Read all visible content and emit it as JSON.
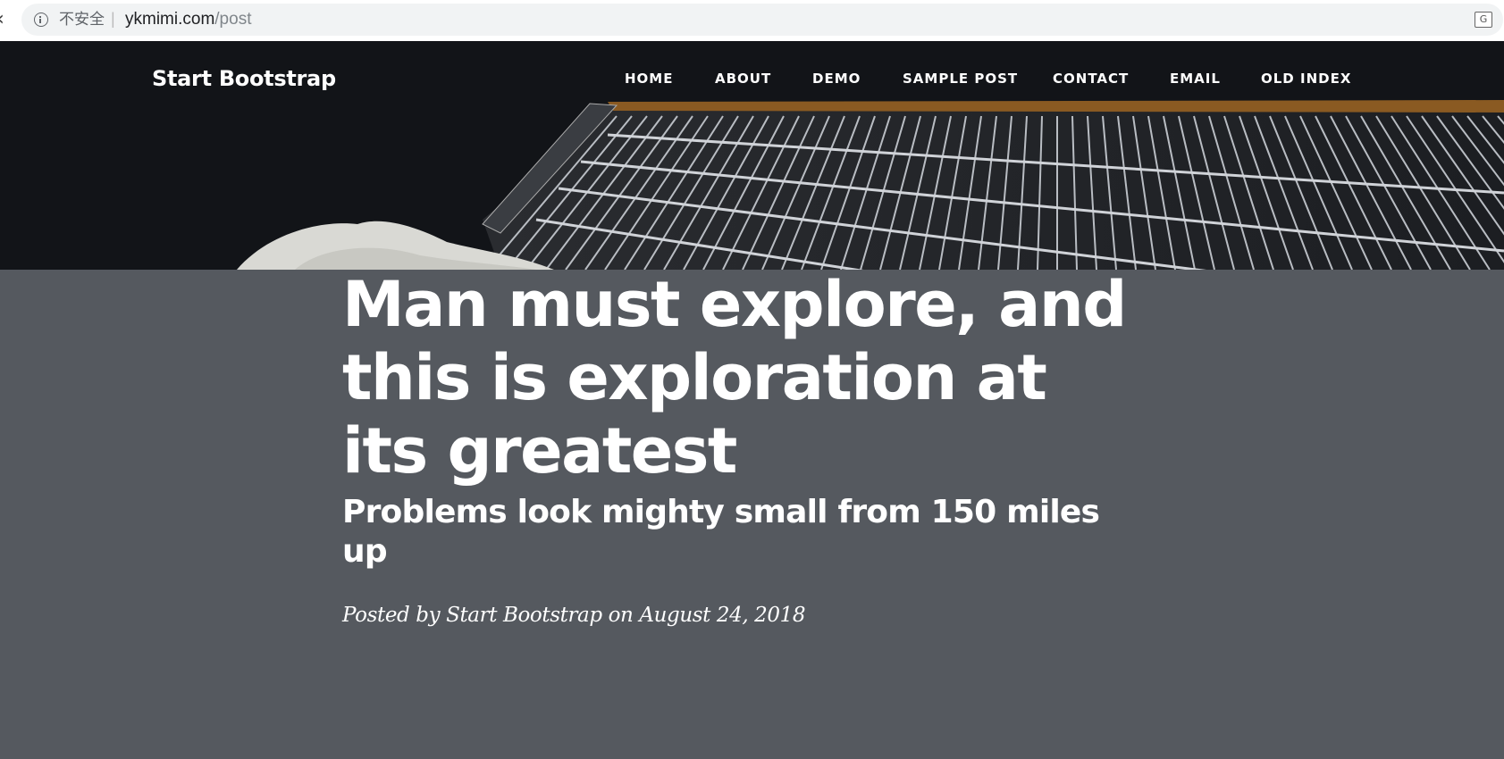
{
  "browser": {
    "security_label": "不安全",
    "url_host": "ykmimi.com",
    "url_path": "/post"
  },
  "navbar": {
    "brand": "Start Bootstrap",
    "links": [
      {
        "label": "HOME"
      },
      {
        "label": "ABOUT"
      },
      {
        "label": "DEMO"
      },
      {
        "label": "SAMPLE POST"
      },
      {
        "label": "CONTACT"
      },
      {
        "label": "EMAIL"
      },
      {
        "label": "OLD INDEX"
      }
    ]
  },
  "post": {
    "title": "Man must explore, and this is exploration at its greatest",
    "subtitle": "Problems look mighty small from 150 miles up",
    "meta": "Posted by Start Bootstrap on August 24, 2018"
  },
  "colors": {
    "header_overlay": "#55595f",
    "hero_background": "#121418",
    "text": "#ffffff"
  }
}
